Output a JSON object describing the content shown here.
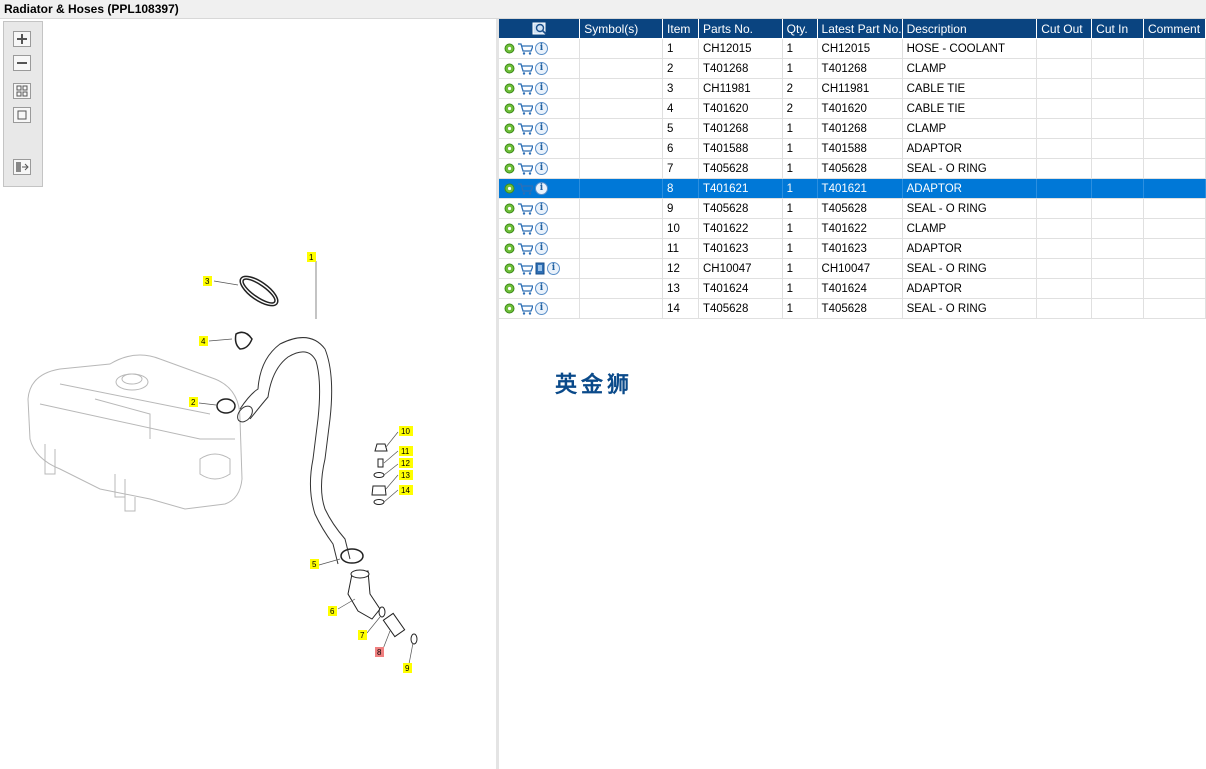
{
  "window": {
    "title": "Radiator & Hoses (PPL108397)"
  },
  "toolbox": {
    "zoom_in": "zoom-in-icon",
    "zoom_out": "zoom-out-icon",
    "fit": "fit-all-icon",
    "actual": "actual-size-icon",
    "layout": "layout-icon"
  },
  "callouts": [
    "1",
    "2",
    "3",
    "4",
    "5",
    "6",
    "7",
    "8",
    "9",
    "10",
    "11",
    "12",
    "13",
    "14"
  ],
  "highlight_color": "#ffff00",
  "selected_callout_color": "#f08080",
  "table": {
    "headers": {
      "symbols": "Symbol(s)",
      "item": "Item",
      "part_no": "Parts No.",
      "qty": "Qty.",
      "latest": "Latest Part No.",
      "description": "Description",
      "cut_out": "Cut Out",
      "cut_in": "Cut In",
      "comment": "Comment"
    },
    "rows": [
      {
        "item": "1",
        "part_no": "CH12015",
        "qty": "1",
        "latest": "CH12015",
        "description": "HOSE - COOLANT"
      },
      {
        "item": "2",
        "part_no": "T401268",
        "qty": "1",
        "latest": "T401268",
        "description": "CLAMP"
      },
      {
        "item": "3",
        "part_no": "CH11981",
        "qty": "2",
        "latest": "CH11981",
        "description": "CABLE TIE"
      },
      {
        "item": "4",
        "part_no": "T401620",
        "qty": "2",
        "latest": "T401620",
        "description": "CABLE TIE"
      },
      {
        "item": "5",
        "part_no": "T401268",
        "qty": "1",
        "latest": "T401268",
        "description": "CLAMP"
      },
      {
        "item": "6",
        "part_no": "T401588",
        "qty": "1",
        "latest": "T401588",
        "description": "ADAPTOR"
      },
      {
        "item": "7",
        "part_no": "T405628",
        "qty": "1",
        "latest": "T405628",
        "description": "SEAL - O RING"
      },
      {
        "item": "8",
        "part_no": "T401621",
        "qty": "1",
        "latest": "T401621",
        "description": "ADAPTOR"
      },
      {
        "item": "9",
        "part_no": "T405628",
        "qty": "1",
        "latest": "T405628",
        "description": "SEAL - O RING"
      },
      {
        "item": "10",
        "part_no": "T401622",
        "qty": "1",
        "latest": "T401622",
        "description": "CLAMP"
      },
      {
        "item": "11",
        "part_no": "T401623",
        "qty": "1",
        "latest": "T401623",
        "description": "ADAPTOR"
      },
      {
        "item": "12",
        "part_no": "CH10047",
        "qty": "1",
        "latest": "CH10047",
        "description": "SEAL - O RING"
      },
      {
        "item": "13",
        "part_no": "T401624",
        "qty": "1",
        "latest": "T401624",
        "description": "ADAPTOR"
      },
      {
        "item": "14",
        "part_no": "T405628",
        "qty": "1",
        "latest": "T405628",
        "description": "SEAL - O RING"
      }
    ],
    "selected_item": "8",
    "header_color": "#0a4480",
    "selected_row_color": "#0078d7"
  },
  "watermark": "英金狮"
}
